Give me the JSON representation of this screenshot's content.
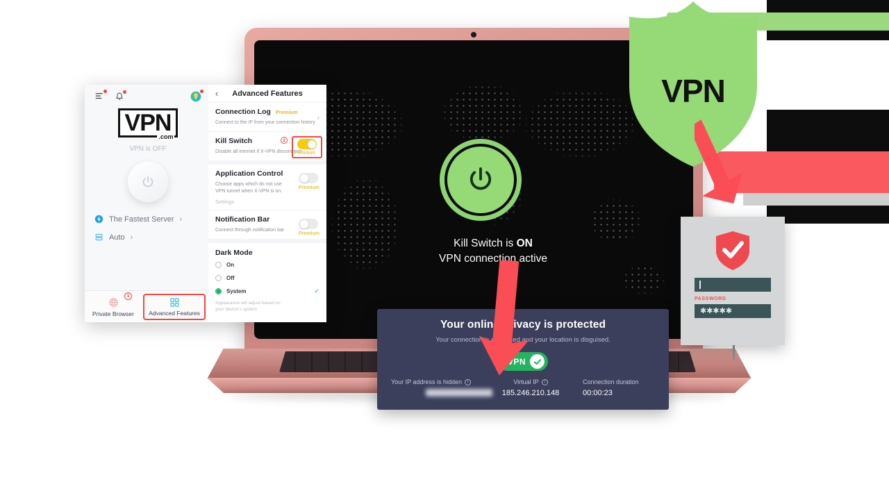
{
  "decor": {
    "bar_green_color": "#9ada7c",
    "bar_red_color": "#fa5a5f",
    "bar_grey_color": "#cfcfcf"
  },
  "shield": {
    "label": "VPN",
    "color": "#96d977",
    "icon": "shield-icon"
  },
  "laptop": {
    "power_button": {
      "icon": "power-icon",
      "color": "#96d977",
      "state": "on"
    },
    "annotation": {
      "line1_prefix": "Kill Switch is ",
      "line1_strong": "ON",
      "line2": "VPN connection active"
    }
  },
  "status_panel": {
    "title": "Your online privacy is protected",
    "subtitle": "Your connection is encrypted and your location is disguised.",
    "badge": {
      "label": "VPN",
      "icon": "check-circle-icon",
      "color": "#24b35f"
    },
    "stats": [
      {
        "label": "Your IP address is hidden",
        "value": "000.000.000.000",
        "blurred": true,
        "info_icon": "info-icon"
      },
      {
        "label": "Virtual IP",
        "value": "185.246.210.148",
        "blurred": false,
        "info_icon": "info-icon"
      },
      {
        "label": "Connection duration",
        "value": "00:00:23",
        "blurred": false,
        "info_icon": ""
      }
    ]
  },
  "phone_app": {
    "topbar": {
      "menu_icon": "menu-icon",
      "bell_icon": "bell-icon",
      "tips_icon": "lightbulb-icon"
    },
    "logo": {
      "main": "VPN",
      "suffix": ".com"
    },
    "connection_status": "VPN is OFF",
    "power_button": {
      "icon": "power-icon",
      "state": "off"
    },
    "server_rows": [
      {
        "label": "The Fastest Server",
        "icon": "bolt-icon",
        "chevron": "›"
      },
      {
        "label": "Auto",
        "icon": "server-stack-icon",
        "chevron": "›"
      }
    ],
    "tabs": [
      {
        "label": "Private Browser",
        "icon": "globe-icon",
        "active": false,
        "badge": "1"
      },
      {
        "label": "Advanced Features",
        "icon": "grid-icon",
        "active": true,
        "badge": ""
      }
    ]
  },
  "advanced_features": {
    "back_icon": "chevron-left-icon",
    "title": "Advanced Features",
    "items": [
      {
        "title": "Connection Log",
        "premium": "Premium",
        "desc": "Connect to the IP from your connection history",
        "sub": "",
        "control": "chevron",
        "toggle_state": "",
        "highlight": false,
        "badge": ""
      },
      {
        "title": "Kill Switch",
        "premium": "",
        "desc": "Disable all internet if X-VPN disconnects",
        "sub": "",
        "control": "toggle",
        "toggle_state": "on",
        "toggle_premium": "Premium",
        "highlight": true,
        "badge": "2"
      },
      {
        "title": "Application Control",
        "premium": "",
        "desc": "Choose apps which do not use VPN tunnel when X-VPN is on.",
        "sub": "Settings",
        "control": "toggle",
        "toggle_state": "off",
        "toggle_premium": "Premium",
        "highlight": false,
        "badge": ""
      },
      {
        "title": "Notification Bar",
        "premium": "",
        "desc": "Connect through notification bar",
        "sub": "",
        "control": "toggle",
        "toggle_state": "off",
        "toggle_premium": "Premium",
        "highlight": false,
        "badge": ""
      }
    ],
    "dark_mode": {
      "title": "Dark Mode",
      "options": [
        {
          "label": "On",
          "selected": false,
          "check": ""
        },
        {
          "label": "Off",
          "selected": false,
          "check": ""
        },
        {
          "label": "System",
          "selected": true,
          "check": "✓"
        }
      ],
      "note": "Appearance will adjust based on your device's system"
    }
  },
  "login_card": {
    "shield_icon": "shield-check-icon",
    "shield_color": "#f0484f",
    "username_value": "",
    "password_label": "PASSWORD",
    "password_mask": "✱✱✱✱✱",
    "field_color": "#3a5457"
  }
}
